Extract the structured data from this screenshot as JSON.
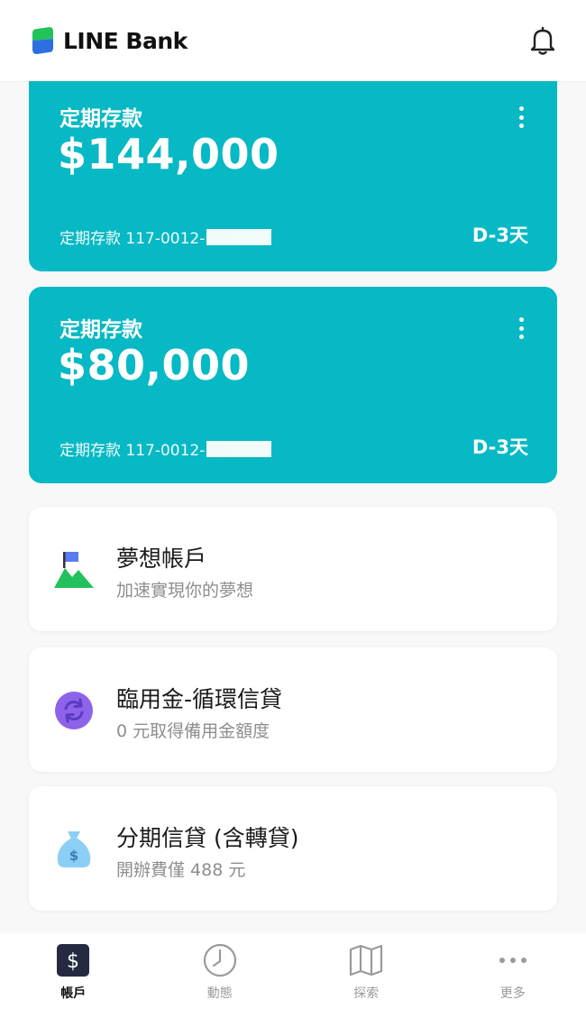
{
  "header": {
    "brand": "LINE Bank"
  },
  "deposits": [
    {
      "title": "定期存款",
      "amount": "$144,000",
      "account_label": "定期存款 117-0012-",
      "days": "D-3天"
    },
    {
      "title": "定期存款",
      "amount": "$80,000",
      "account_label": "定期存款 117-0012-",
      "days": "D-3天"
    }
  ],
  "features": [
    {
      "title": "夢想帳戶",
      "subtitle": "加速實現你的夢想",
      "icon": "mountain-flag-icon"
    },
    {
      "title": "臨用金-循環信貸",
      "subtitle": "0 元取得備用金額度",
      "icon": "revolving-arrows-icon"
    },
    {
      "title": "分期信貸 (含轉貸)",
      "subtitle": "開辦費僅 488 元",
      "icon": "money-bag-icon"
    }
  ],
  "nav": [
    {
      "label": "帳戶",
      "icon": "dollar-icon",
      "active": true
    },
    {
      "label": "動態",
      "icon": "clock-icon",
      "active": false
    },
    {
      "label": "探索",
      "icon": "map-icon",
      "active": false
    },
    {
      "label": "更多",
      "icon": "more-dots-icon",
      "active": false
    }
  ],
  "colors": {
    "card": "#06b9c4",
    "logo_green": "#21c35b",
    "logo_blue": "#2d6fe0",
    "flag_blue": "#5b7cf0",
    "mountain_green": "#22c15e",
    "loan_purple": "#8d63ea",
    "bag_blue": "#8ccff5"
  }
}
